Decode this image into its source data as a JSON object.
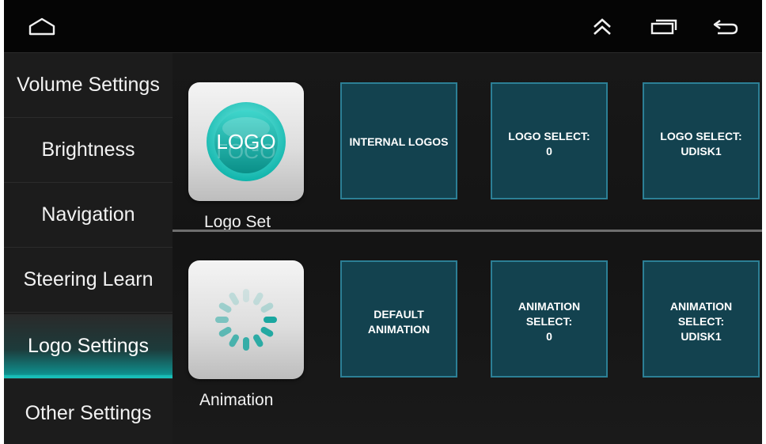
{
  "sidebar": {
    "items": [
      {
        "label": "Volume Settings"
      },
      {
        "label": "Brightness"
      },
      {
        "label": "Navigation"
      },
      {
        "label": "Steering Learn"
      },
      {
        "label": "Logo Settings",
        "active": true
      },
      {
        "label": "Other Settings"
      }
    ]
  },
  "topbar": {
    "icons": [
      "home-icon",
      "double-chevron-up-icon",
      "recent-apps-icon",
      "back-icon"
    ]
  },
  "logo_section": {
    "icon_text": "LOGO",
    "caption": "Logo Set",
    "tiles": [
      "INTERNAL LOGOS",
      "LOGO SELECT:\n0",
      "LOGO SELECT:\nUDISK1"
    ]
  },
  "animation_section": {
    "caption": "Animation",
    "tiles": [
      "DEFAULT\nANIMATION",
      "ANIMATION\nSELECT:\n0",
      "ANIMATION\nSELECT:\nUDISK1"
    ]
  },
  "colors": {
    "accent": "#1fd0c8",
    "tile_bg": "#13424f",
    "tile_border": "#2c7f95"
  }
}
